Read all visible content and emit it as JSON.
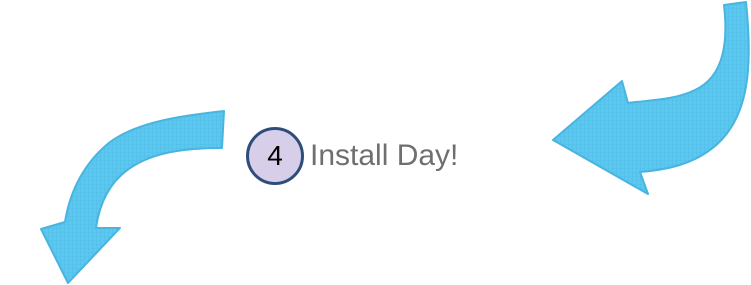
{
  "step": {
    "number": "4",
    "label": "Install Day!"
  },
  "colors": {
    "arrow_fill": "#5bc8ef",
    "arrow_outline": "#49b4e0",
    "arrow_pattern": "#3aa6d6",
    "badge_fill": "#d7cfea",
    "badge_border": "#2f4d7a",
    "label_text": "#6f6f6f"
  },
  "arrows": [
    {
      "name": "incoming-arrow",
      "direction": "pointing-left"
    },
    {
      "name": "outgoing-arrow",
      "direction": "pointing-down-left"
    }
  ]
}
